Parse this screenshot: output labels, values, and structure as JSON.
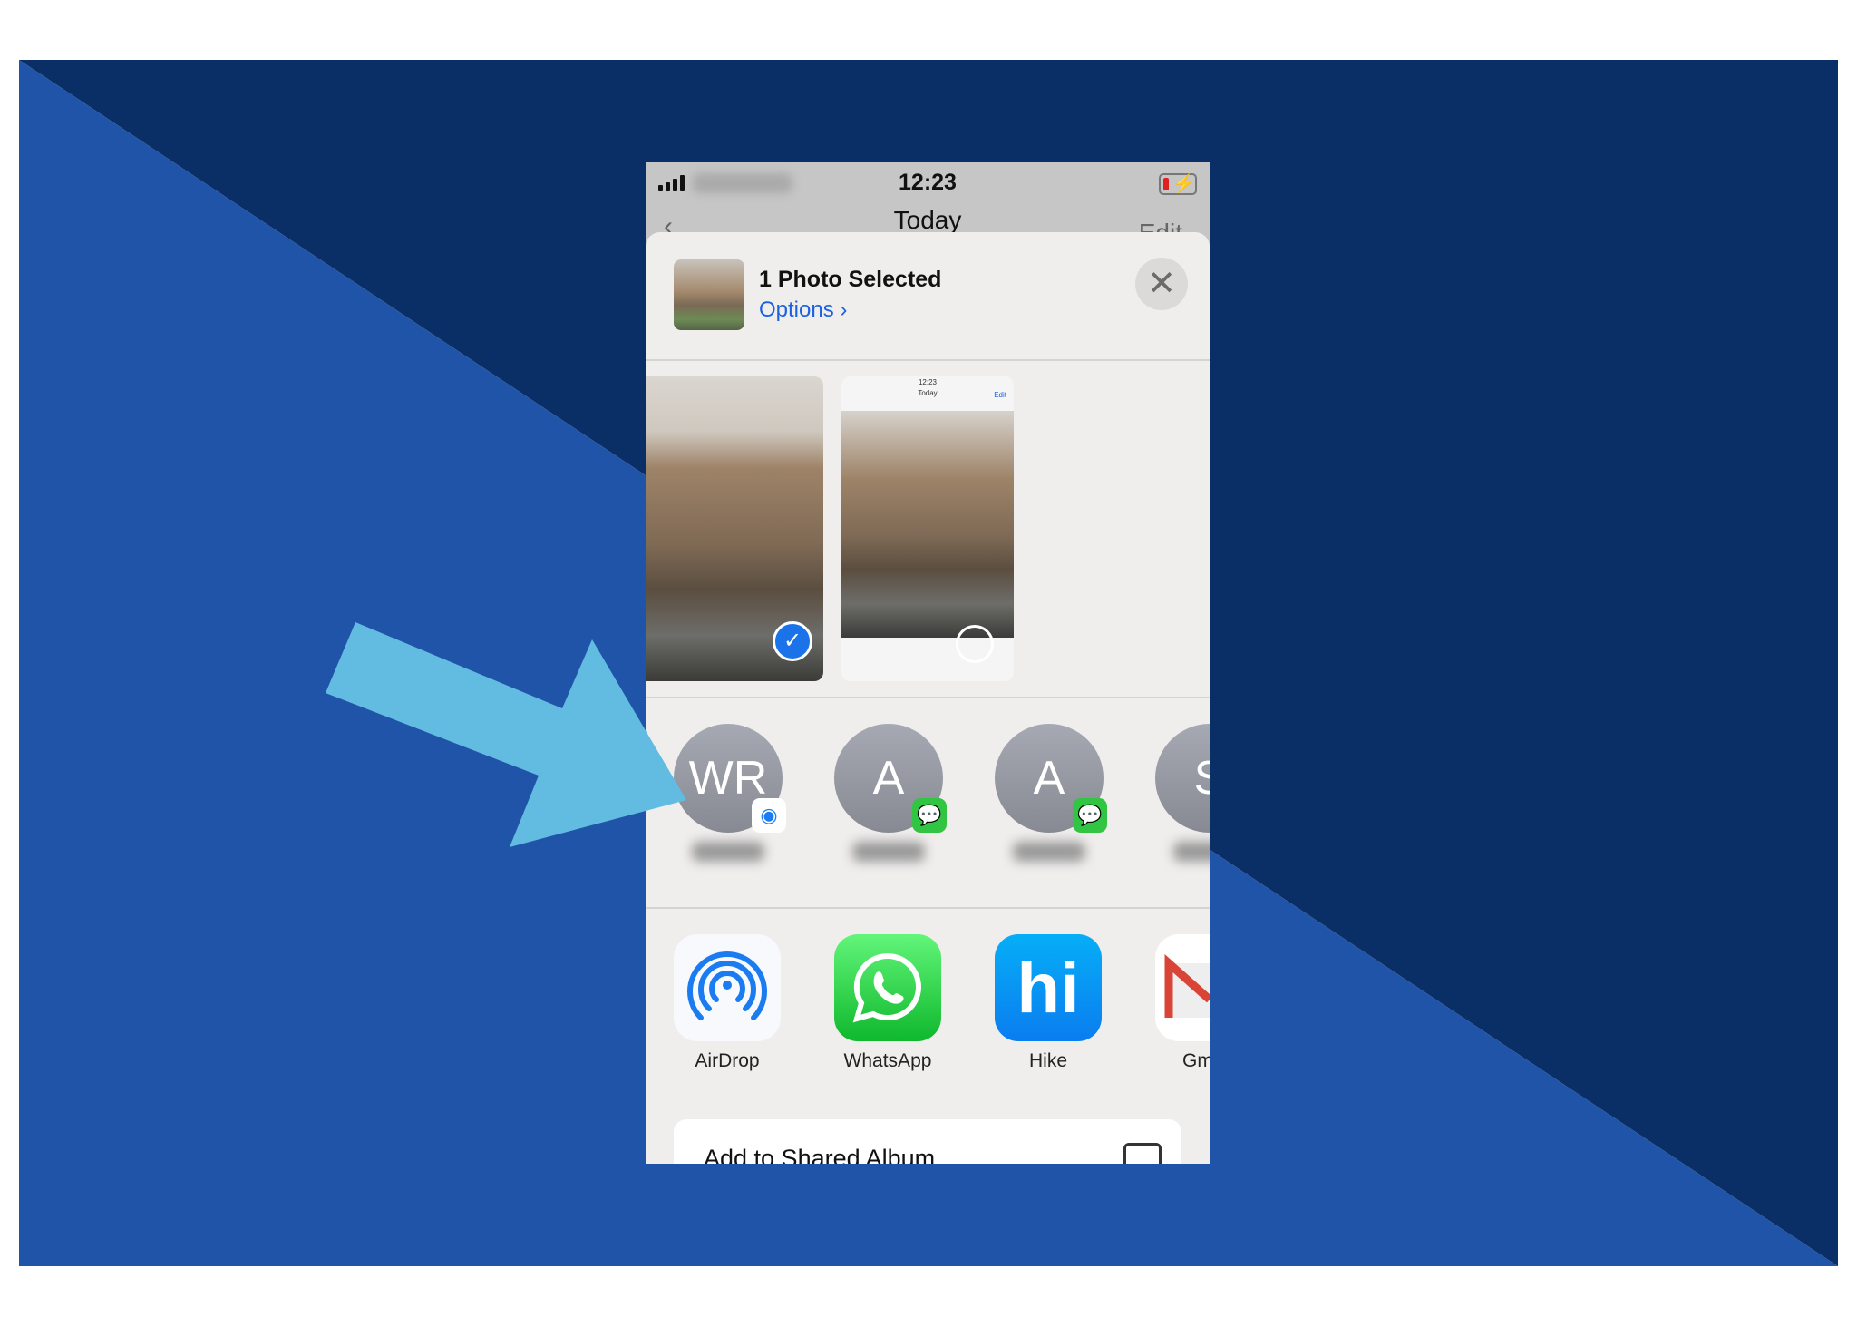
{
  "colors": {
    "bg_light": "#2054a8",
    "bg_dark": "#0a2f66",
    "arrow": "#62bbe0",
    "link": "#1b62e0"
  },
  "status": {
    "time": "12:23",
    "icons": [
      "signal-icon",
      "battery-charging-icon"
    ]
  },
  "nav": {
    "title": "Today",
    "right": "Edit"
  },
  "share": {
    "title": "1 Photo Selected",
    "options_label": "Options",
    "close_icon": "close-icon"
  },
  "photos": [
    {
      "selected": true,
      "mini_status": "",
      "mini_title": ""
    },
    {
      "selected": false,
      "mini_status": "12:23",
      "mini_title": "Today",
      "mini_edit": "Edit"
    }
  ],
  "people": [
    {
      "initials": "WR",
      "badge": "airdrop-icon"
    },
    {
      "initials": "A",
      "badge": "messages-icon"
    },
    {
      "initials": "A",
      "badge": "messages-icon"
    },
    {
      "initials": "S",
      "badge": ""
    }
  ],
  "apps": [
    {
      "label": "AirDrop",
      "icon": "airdrop-icon"
    },
    {
      "label": "WhatsApp",
      "icon": "whatsapp-icon"
    },
    {
      "label": "Hike",
      "icon": "hike-icon"
    },
    {
      "label": "Gm",
      "icon": "gmail-icon"
    }
  ],
  "action": {
    "label": "Add to Shared Album",
    "icon": "shared-album-icon"
  }
}
